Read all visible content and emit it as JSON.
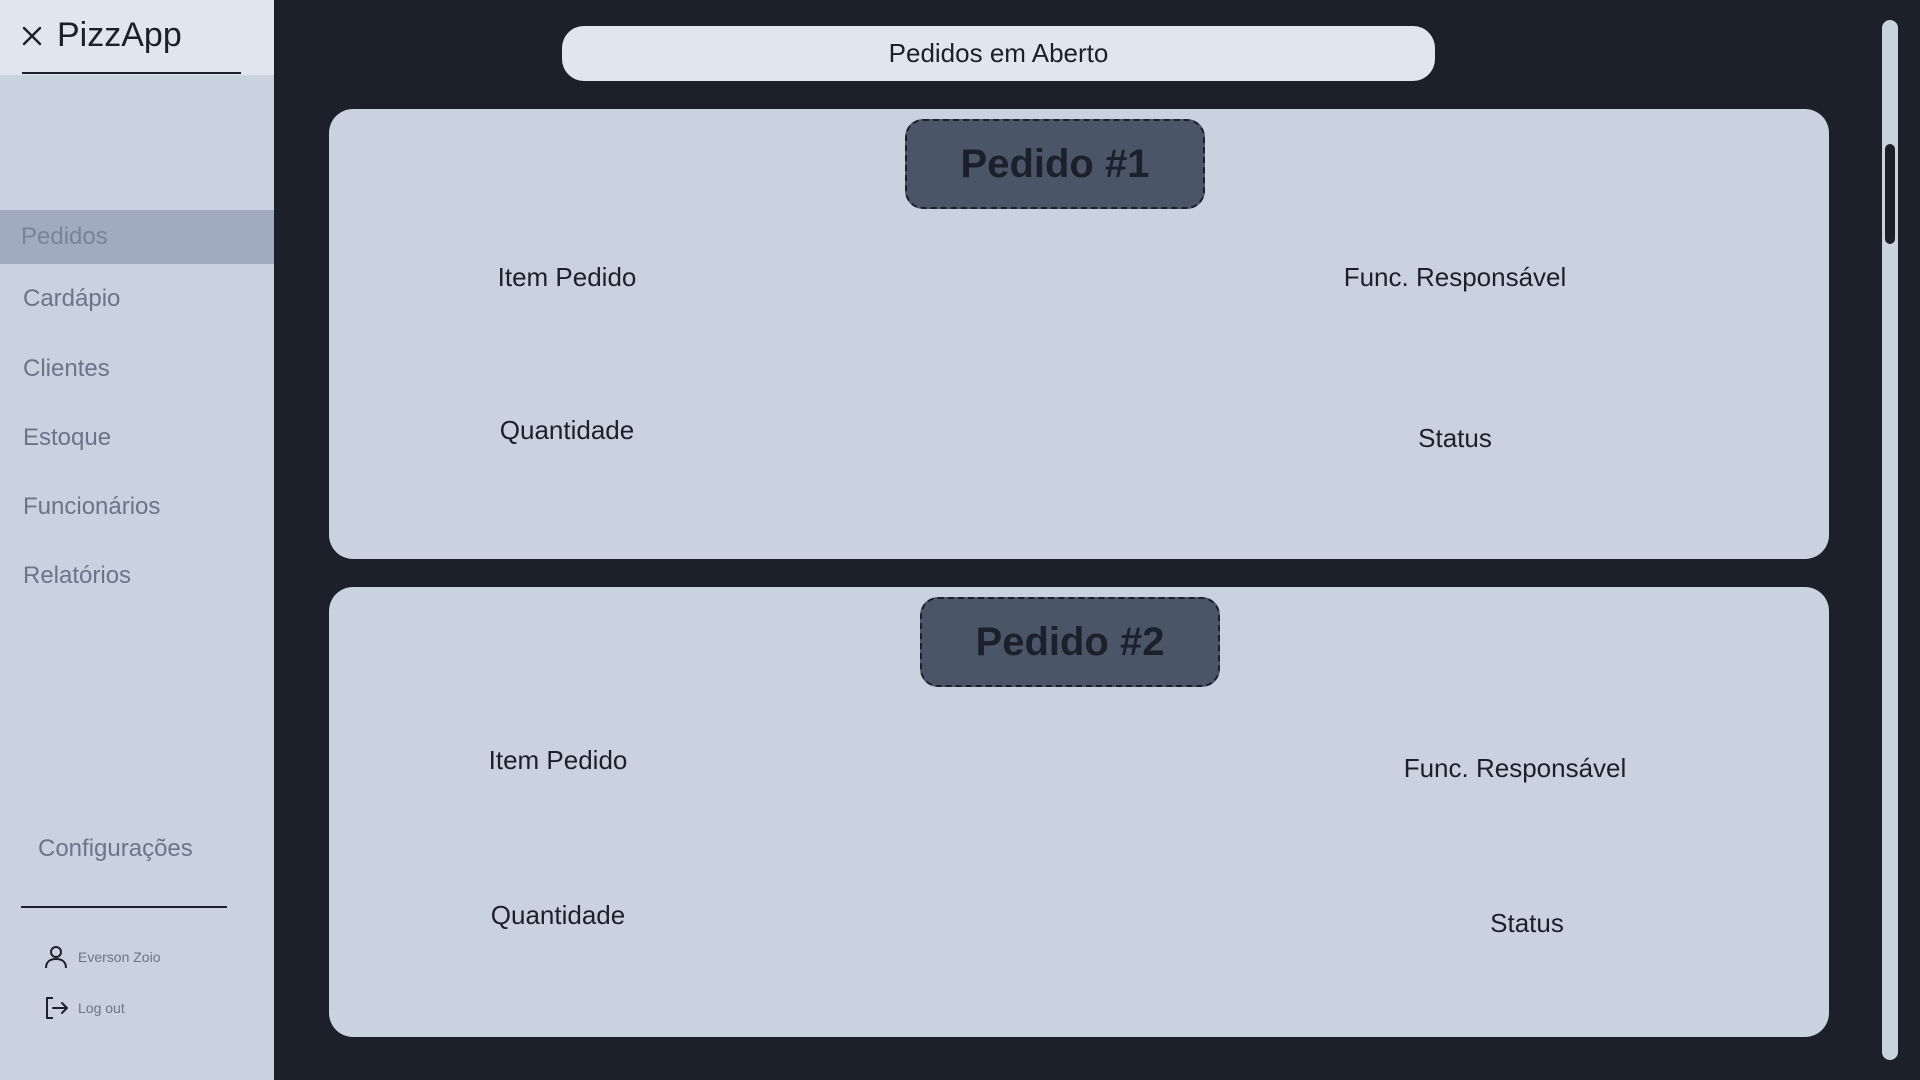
{
  "app": {
    "name": "PizzApp"
  },
  "sidebar": {
    "items": [
      {
        "label": "Pedidos",
        "active": true
      },
      {
        "label": "Cardápio"
      },
      {
        "label": "Clientes"
      },
      {
        "label": "Estoque"
      },
      {
        "label": "Funcionários"
      },
      {
        "label": "Relatórios"
      }
    ],
    "settings_label": "Configurações",
    "user_name": "Everson Zoio",
    "logout_label": "Log out"
  },
  "main": {
    "title": "Pedidos em Aberto",
    "orders": [
      {
        "title": "Pedido #1",
        "item_label": "Item Pedido",
        "employee_label": "Func. Responsável",
        "quantity_label": "Quantidade",
        "status_label": "Status"
      },
      {
        "title": "Pedido #2",
        "item_label": "Item Pedido",
        "employee_label": "Func. Responsável",
        "quantity_label": "Quantidade",
        "status_label": "Status"
      }
    ]
  },
  "icons": {
    "close": "close-icon",
    "user": "user-icon",
    "logout": "logout-icon"
  },
  "colors": {
    "background": "#1b202b",
    "sidebar": "#cbd2df",
    "active_item": "#a1abbf",
    "badge": "#4a5568",
    "muted_text": "#6b7489"
  }
}
